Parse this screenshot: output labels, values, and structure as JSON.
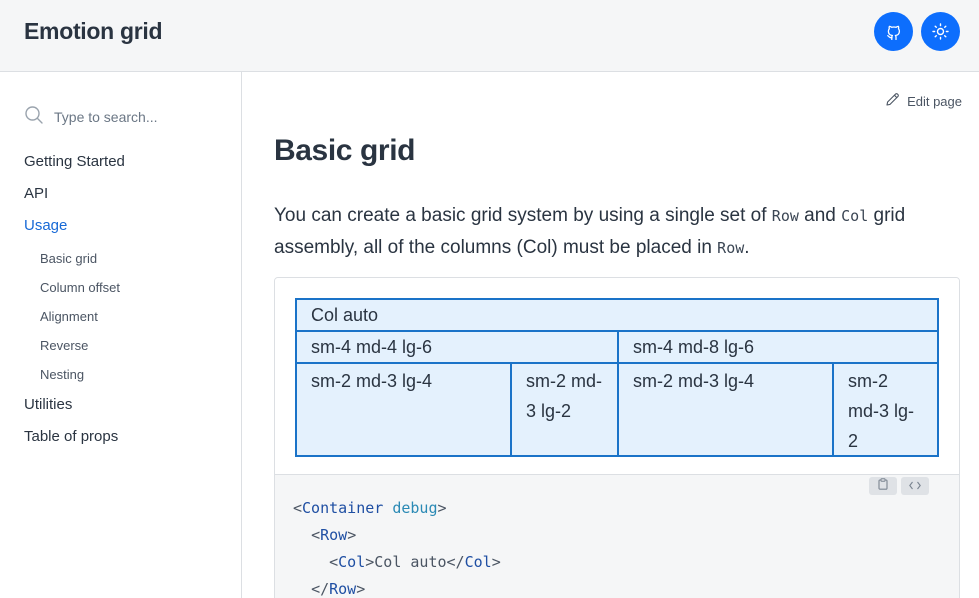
{
  "header": {
    "brand": "Emotion grid",
    "github_icon": "github-icon",
    "theme_icon": "sun-icon",
    "accent": "#0d6efd"
  },
  "sidebar": {
    "search": {
      "placeholder": "Type to search..."
    },
    "items": [
      {
        "label": "Getting Started"
      },
      {
        "label": "API"
      },
      {
        "label": "Usage",
        "active": true
      },
      {
        "label": "Utilities"
      },
      {
        "label": "Table of props"
      }
    ],
    "usage_children": [
      {
        "label": "Basic grid"
      },
      {
        "label": "Column offset"
      },
      {
        "label": "Alignment"
      },
      {
        "label": "Reverse"
      },
      {
        "label": "Nesting"
      }
    ],
    "active_color": "#1769d6"
  },
  "main": {
    "edit_label": "Edit page",
    "title": "Basic grid",
    "intro": {
      "part1": "You can create a basic grid system by using a single set of ",
      "code1": "Row",
      "part2": " and ",
      "code2": "Col",
      "part3": " grid assembly, all of the columns (Col) must be placed in ",
      "code3": "Row",
      "part4": "."
    }
  },
  "example": {
    "rows": [
      [
        {
          "label": "Col auto"
        }
      ],
      [
        {
          "label": "sm-4 md-4 lg-6"
        },
        {
          "label": "sm-4 md-8 lg-6"
        }
      ],
      [
        {
          "label": "sm-2 md-3 lg-4"
        },
        {
          "label": "sm-2 md-3 lg-2"
        },
        {
          "label": "sm-2 md-3 lg-4"
        },
        {
          "label": "sm-2 md-3 lg-2"
        }
      ]
    ],
    "cell_bg": "#e4f1fd",
    "border_color": "#1a73c8",
    "actions": {
      "copy_icon": "clipboard-icon",
      "toggle_icon": "code-icon"
    },
    "code_lines": {
      "l1_open": "<",
      "l1_tag": "Container",
      "l1_attr": "debug",
      "l1_close": ">",
      "l2_open": "<",
      "l2_tag": "Row",
      "l2_close": ">",
      "l3_open": "<",
      "l3_tag": "Col",
      "l3_mid": ">Col auto</",
      "l3_tag2": "Col",
      "l3_close": ">",
      "l4_open": "</",
      "l4_tag": "Row",
      "l4_close": ">"
    }
  }
}
